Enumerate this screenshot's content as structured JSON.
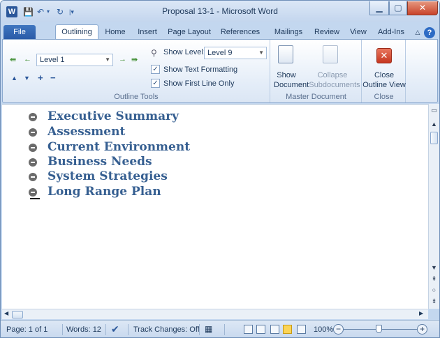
{
  "window": {
    "title": "Proposal 13-1 - Microsoft Word",
    "app_icon": "W",
    "qat": {
      "save_icon": "save-icon",
      "undo_icon": "undo-icon",
      "redo_icon": "redo-icon",
      "customize_icon": "customize-qat-icon"
    }
  },
  "tabs": [
    {
      "label": "File"
    },
    {
      "label": "Outlining"
    },
    {
      "label": "Home"
    },
    {
      "label": "Insert"
    },
    {
      "label": "Page Layout"
    },
    {
      "label": "References"
    },
    {
      "label": "Mailings"
    },
    {
      "label": "Review"
    },
    {
      "label": "View"
    },
    {
      "label": "Add-Ins"
    }
  ],
  "ribbon": {
    "outline_tools": {
      "label": "Outline Tools",
      "level_select": "Level 1",
      "show_level_label": "Show Level:",
      "show_level_value": "Level 9",
      "show_text_formatting": "Show Text Formatting",
      "show_first_line_only": "Show First Line Only",
      "show_text_formatting_checked": true,
      "show_first_line_only_checked": true
    },
    "master_document": {
      "label": "Master Document",
      "show_document_line1": "Show",
      "show_document_line2": "Document",
      "collapse_line1": "Collapse",
      "collapse_line2": "Subdocuments"
    },
    "close_group": {
      "label": "Close",
      "close_line1": "Close",
      "close_line2": "Outline View"
    }
  },
  "outline": [
    {
      "text": "Executive Summary"
    },
    {
      "text": "Assessment"
    },
    {
      "text": "Current Environment"
    },
    {
      "text": "Business Needs"
    },
    {
      "text": "System Strategies"
    },
    {
      "text": "Long Range Plan"
    }
  ],
  "status": {
    "page": "Page: 1 of 1",
    "words": "Words: 12",
    "track_changes": "Track Changes: Off",
    "zoom": "100%",
    "zoom_out": "−",
    "zoom_in": "+"
  },
  "colors": {
    "heading": "#365f91",
    "ribbon_bg": "#dbe6f4",
    "frame": "#c3d7ef",
    "file_tab": "#2a5aa7"
  }
}
